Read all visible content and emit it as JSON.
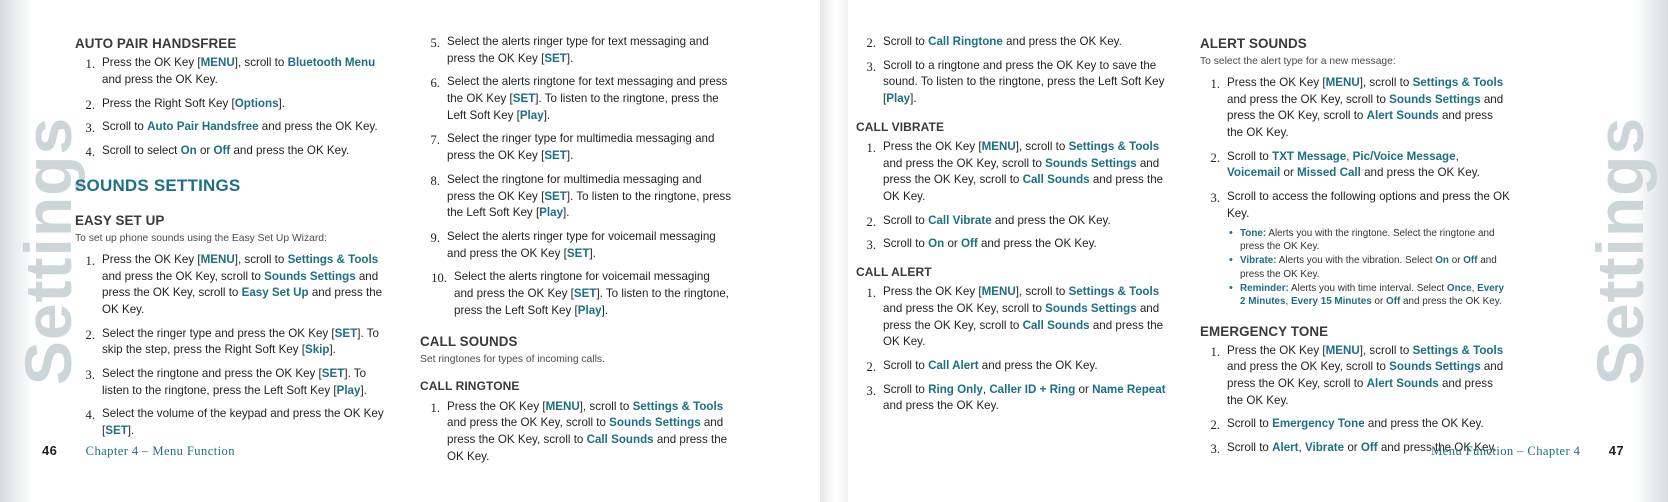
{
  "document": {
    "watermark_label": "Settings",
    "accent_color": "#1c6f84",
    "heading_color": "#3a3a3c"
  },
  "left_page": {
    "footer": {
      "page_number": "46",
      "text": "Chapter 4 – Menu Function"
    },
    "column1": {
      "heading_auto_pair": "AUTO PAIR HANDSFREE",
      "auto_pair_steps": [
        {
          "num": "1.",
          "parts": [
            {
              "t": "Press the OK Key ["
            },
            {
              "hl": "MENU"
            },
            {
              "t": "], scroll to "
            },
            {
              "hl": "Bluetooth Menu"
            },
            {
              "t": " and press the OK Key."
            }
          ]
        },
        {
          "num": "2.",
          "parts": [
            {
              "t": "Press the Right Soft Key ["
            },
            {
              "hl": "Options"
            },
            {
              "t": "]."
            }
          ]
        },
        {
          "num": "3.",
          "parts": [
            {
              "t": "Scroll to "
            },
            {
              "hl": "Auto Pair Handsfree"
            },
            {
              "t": " and press the OK Key."
            }
          ]
        },
        {
          "num": "4.",
          "parts": [
            {
              "t": "Scroll to select "
            },
            {
              "hl": "On"
            },
            {
              "t": " or "
            },
            {
              "hl": "Off"
            },
            {
              "t": " and press the OK Key."
            }
          ]
        }
      ],
      "heading_sounds_settings": "SOUNDS SETTINGS",
      "heading_easy_set_up": "EASY SET UP",
      "easy_set_up_intro": "To set up phone sounds using the Easy Set Up Wizard:",
      "easy_set_up_steps": [
        {
          "num": "1.",
          "parts": [
            {
              "t": "Press the OK Key ["
            },
            {
              "hl": "MENU"
            },
            {
              "t": "], scroll to "
            },
            {
              "hl": "Settings & Tools"
            },
            {
              "t": " and press the OK Key, scroll to "
            },
            {
              "hl": "Sounds Settings"
            },
            {
              "t": " and press the OK Key, scroll to "
            },
            {
              "hl": "Easy Set Up"
            },
            {
              "t": " and press the OK Key."
            }
          ]
        },
        {
          "num": "2.",
          "parts": [
            {
              "t": "Select the ringer type and press the OK Key ["
            },
            {
              "hl": "SET"
            },
            {
              "t": "]. To skip the step, press the Right Soft Key ["
            },
            {
              "hl": "Skip"
            },
            {
              "t": "]."
            }
          ]
        },
        {
          "num": "3.",
          "parts": [
            {
              "t": "Select the ringtone and press the OK Key ["
            },
            {
              "hl": "SET"
            },
            {
              "t": "]. To listen to the ringtone, press the Left Soft Key ["
            },
            {
              "hl": "Play"
            },
            {
              "t": "]."
            }
          ]
        },
        {
          "num": "4.",
          "parts": [
            {
              "t": "Select the volume of the keypad and press the OK Key ["
            },
            {
              "hl": "SET"
            },
            {
              "t": "]."
            }
          ]
        }
      ]
    },
    "column2": {
      "easy_set_up_steps_cont": [
        {
          "num": "5.",
          "parts": [
            {
              "t": "Select the alerts ringer type for text messaging and press the OK Key ["
            },
            {
              "hl": "SET"
            },
            {
              "t": "]."
            }
          ]
        },
        {
          "num": "6.",
          "parts": [
            {
              "t": "Select the alerts ringtone for text messaging and press the OK Key ["
            },
            {
              "hl": "SET"
            },
            {
              "t": "]. To listen to the ringtone, press the Left Soft Key ["
            },
            {
              "hl": "Play"
            },
            {
              "t": "]."
            }
          ]
        },
        {
          "num": "7.",
          "parts": [
            {
              "t": "Select the ringer type for multimedia messaging and press the OK Key ["
            },
            {
              "hl": "SET"
            },
            {
              "t": "]."
            }
          ]
        },
        {
          "num": "8.",
          "parts": [
            {
              "t": "Select the ringtone for multimedia messaging and press the OK Key ["
            },
            {
              "hl": "SET"
            },
            {
              "t": "]. To listen to the ringtone, press the Left Soft Key ["
            },
            {
              "hl": "Play"
            },
            {
              "t": "]."
            }
          ]
        },
        {
          "num": "9.",
          "parts": [
            {
              "t": "Select the alerts ringer type for voicemail messaging and press the OK Key ["
            },
            {
              "hl": "SET"
            },
            {
              "t": "]."
            }
          ]
        },
        {
          "num": "10.",
          "wide": true,
          "parts": [
            {
              "t": "Select the alerts ringtone for voicemail messaging and press the OK Key ["
            },
            {
              "hl": "SET"
            },
            {
              "t": "]. To listen to the ringtone, press the Left Soft Key ["
            },
            {
              "hl": "Play"
            },
            {
              "t": "]."
            }
          ]
        }
      ],
      "heading_call_sounds": "CALL SOUNDS",
      "call_sounds_intro": "Set ringtones for types of incoming calls.",
      "heading_call_ringtone": "CALL RINGTONE",
      "call_ringtone_steps": [
        {
          "num": "1.",
          "parts": [
            {
              "t": "Press the OK Key ["
            },
            {
              "hl": "MENU"
            },
            {
              "t": "], scroll to "
            },
            {
              "hl": "Settings & Tools"
            },
            {
              "t": " and press the OK Key, scroll to "
            },
            {
              "hl": "Sounds Settings"
            },
            {
              "t": " and press the OK Key, scroll to "
            },
            {
              "hl": "Call Sounds"
            },
            {
              "t": " and press the OK Key."
            }
          ]
        }
      ]
    }
  },
  "right_page": {
    "footer": {
      "page_number": "47",
      "text": "Menu Function – Chapter 4"
    },
    "column1": {
      "call_ringtone_steps_cont": [
        {
          "num": "2.",
          "parts": [
            {
              "t": "Scroll to "
            },
            {
              "hl": "Call Ringtone"
            },
            {
              "t": " and press the OK Key."
            }
          ]
        },
        {
          "num": "3.",
          "parts": [
            {
              "t": "Scroll to a ringtone and press the OK Key to save the sound. To listen to the ringtone, press the Left Soft Key ["
            },
            {
              "hl": "Play"
            },
            {
              "t": "]."
            }
          ]
        }
      ],
      "heading_call_vibrate": "CALL VIBRATE",
      "call_vibrate_steps": [
        {
          "num": "1.",
          "parts": [
            {
              "t": "Press the OK Key ["
            },
            {
              "hl": "MENU"
            },
            {
              "t": "], scroll to "
            },
            {
              "hl": "Settings & Tools"
            },
            {
              "t": " and press the OK Key, scroll to "
            },
            {
              "hl": "Sounds Settings"
            },
            {
              "t": " and press the OK Key, scroll to "
            },
            {
              "hl": "Call Sounds"
            },
            {
              "t": " and press the OK Key."
            }
          ]
        },
        {
          "num": "2.",
          "parts": [
            {
              "t": "Scroll to "
            },
            {
              "hl": "Call Vibrate"
            },
            {
              "t": " and press the OK Key."
            }
          ]
        },
        {
          "num": "3.",
          "parts": [
            {
              "t": "Scroll to "
            },
            {
              "hl": "On"
            },
            {
              "t": " or "
            },
            {
              "hl": "Off"
            },
            {
              "t": " and press the OK Key."
            }
          ]
        }
      ],
      "heading_call_alert": "CALL ALERT",
      "call_alert_steps": [
        {
          "num": "1.",
          "parts": [
            {
              "t": "Press the OK Key ["
            },
            {
              "hl": "MENU"
            },
            {
              "t": "], scroll to "
            },
            {
              "hl": "Settings & Tools"
            },
            {
              "t": " and press the OK Key, scroll to "
            },
            {
              "hl": "Sounds Settings"
            },
            {
              "t": " and press the OK Key, scroll to "
            },
            {
              "hl": "Call Sounds"
            },
            {
              "t": " and press the OK Key."
            }
          ]
        },
        {
          "num": "2.",
          "parts": [
            {
              "t": "Scroll to "
            },
            {
              "hl": "Call Alert"
            },
            {
              "t": " and press the OK Key."
            }
          ]
        },
        {
          "num": "3.",
          "parts": [
            {
              "t": "Scroll to "
            },
            {
              "hl": "Ring Only"
            },
            {
              "t": ", "
            },
            {
              "hl": "Caller ID + Ring"
            },
            {
              "t": " or "
            },
            {
              "hl": "Name Repeat"
            },
            {
              "t": " and press the OK Key."
            }
          ]
        }
      ]
    },
    "column2": {
      "heading_alert_sounds": "ALERT SOUNDS",
      "alert_sounds_intro": "To select the alert type for a new message:",
      "alert_sounds_steps": [
        {
          "num": "1.",
          "parts": [
            {
              "t": "Press the OK Key ["
            },
            {
              "hl": "MENU"
            },
            {
              "t": "], scroll to "
            },
            {
              "hl": "Settings & Tools"
            },
            {
              "t": " and press the OK Key, scroll to "
            },
            {
              "hl": "Sounds Settings"
            },
            {
              "t": " and press the OK Key, scroll to "
            },
            {
              "hl": "Alert Sounds"
            },
            {
              "t": " and press the OK Key."
            }
          ]
        },
        {
          "num": "2.",
          "parts": [
            {
              "t": "Scroll to "
            },
            {
              "hl": "TXT Message"
            },
            {
              "t": ", "
            },
            {
              "hl": "Pic/Voice Message"
            },
            {
              "t": ", "
            },
            {
              "hl": "Voicemail"
            },
            {
              "t": " or "
            },
            {
              "hl": "Missed Call"
            },
            {
              "t": " and press the OK Key."
            }
          ]
        },
        {
          "num": "3.",
          "parts": [
            {
              "t": "Scroll to access the following options and press the OK Key."
            }
          ],
          "bullets": [
            {
              "label": "Tone:",
              "parts": [
                {
                  "t": " Alerts you with the ringtone. Select the ringtone and press the OK Key."
                }
              ]
            },
            {
              "label": "Vibrate:",
              "parts": [
                {
                  "t": " Alerts you with the vibration. Select "
                },
                {
                  "hl": "On"
                },
                {
                  "t": " or "
                },
                {
                  "hl": "Off"
                },
                {
                  "t": " and press the OK Key."
                }
              ]
            },
            {
              "label": "Reminder:",
              "parts": [
                {
                  "t": " Alerts you with time interval. Select "
                },
                {
                  "hl": "Once"
                },
                {
                  "t": ", "
                },
                {
                  "hl": "Every 2 Minutes"
                },
                {
                  "t": ", "
                },
                {
                  "hl": "Every 15 Minutes"
                },
                {
                  "t": " or "
                },
                {
                  "hl": "Off"
                },
                {
                  "t": " and press the OK Key."
                }
              ]
            }
          ]
        }
      ],
      "heading_emergency_tone": "EMERGENCY TONE",
      "emergency_tone_steps": [
        {
          "num": "1.",
          "parts": [
            {
              "t": "Press the OK Key ["
            },
            {
              "hl": "MENU"
            },
            {
              "t": "], scroll to "
            },
            {
              "hl": "Settings & Tools"
            },
            {
              "t": " and press the OK Key, scroll to "
            },
            {
              "hl": "Sounds Settings"
            },
            {
              "t": " and press the OK Key, scroll to "
            },
            {
              "hl": "Alert Sounds"
            },
            {
              "t": " and press the OK Key."
            }
          ]
        },
        {
          "num": "2.",
          "parts": [
            {
              "t": "Scroll to "
            },
            {
              "hl": "Emergency Tone"
            },
            {
              "t": " and press the OK Key."
            }
          ]
        },
        {
          "num": "3.",
          "parts": [
            {
              "t": "Scroll to "
            },
            {
              "hl": "Alert"
            },
            {
              "t": ", "
            },
            {
              "hl": "Vibrate"
            },
            {
              "t": " or "
            },
            {
              "hl": "Off"
            },
            {
              "t": " and press the OK Key."
            }
          ]
        }
      ]
    }
  }
}
